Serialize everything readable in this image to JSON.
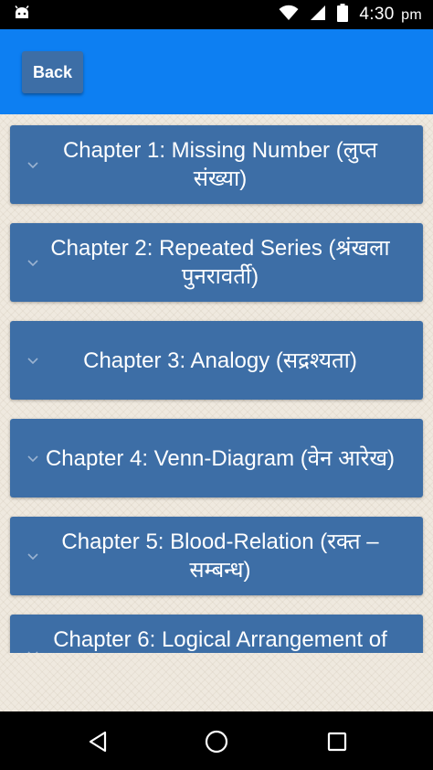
{
  "status_bar": {
    "time": "4:30",
    "time_suffix": "pm",
    "icons": [
      "android-debug-icon",
      "wifi-icon",
      "cellular-signal-icon",
      "battery-icon"
    ]
  },
  "header": {
    "back_label": "Back"
  },
  "chapters": [
    {
      "title": "Chapter 1: Missing Number (लुप्त संख्या)"
    },
    {
      "title": "Chapter 2: Repeated Series (श्रंखला पुनरावर्ती)"
    },
    {
      "title": "Chapter 3: Analogy (सद्रश्यता)"
    },
    {
      "title": "Chapter 4: Venn-Diagram (वेन आरेख)"
    },
    {
      "title": "Chapter 5: Blood-Relation (रक्त – सम्बन्ध)"
    },
    {
      "title": "Chapter 6: Logical Arrangement of"
    }
  ],
  "nav_bar": {
    "icons": [
      "back-triangle-icon",
      "home-circle-icon",
      "recents-square-icon"
    ]
  },
  "colors": {
    "app_bar": "#0d7ff2",
    "card": "#3d6ea6",
    "background": "#efe9df"
  }
}
